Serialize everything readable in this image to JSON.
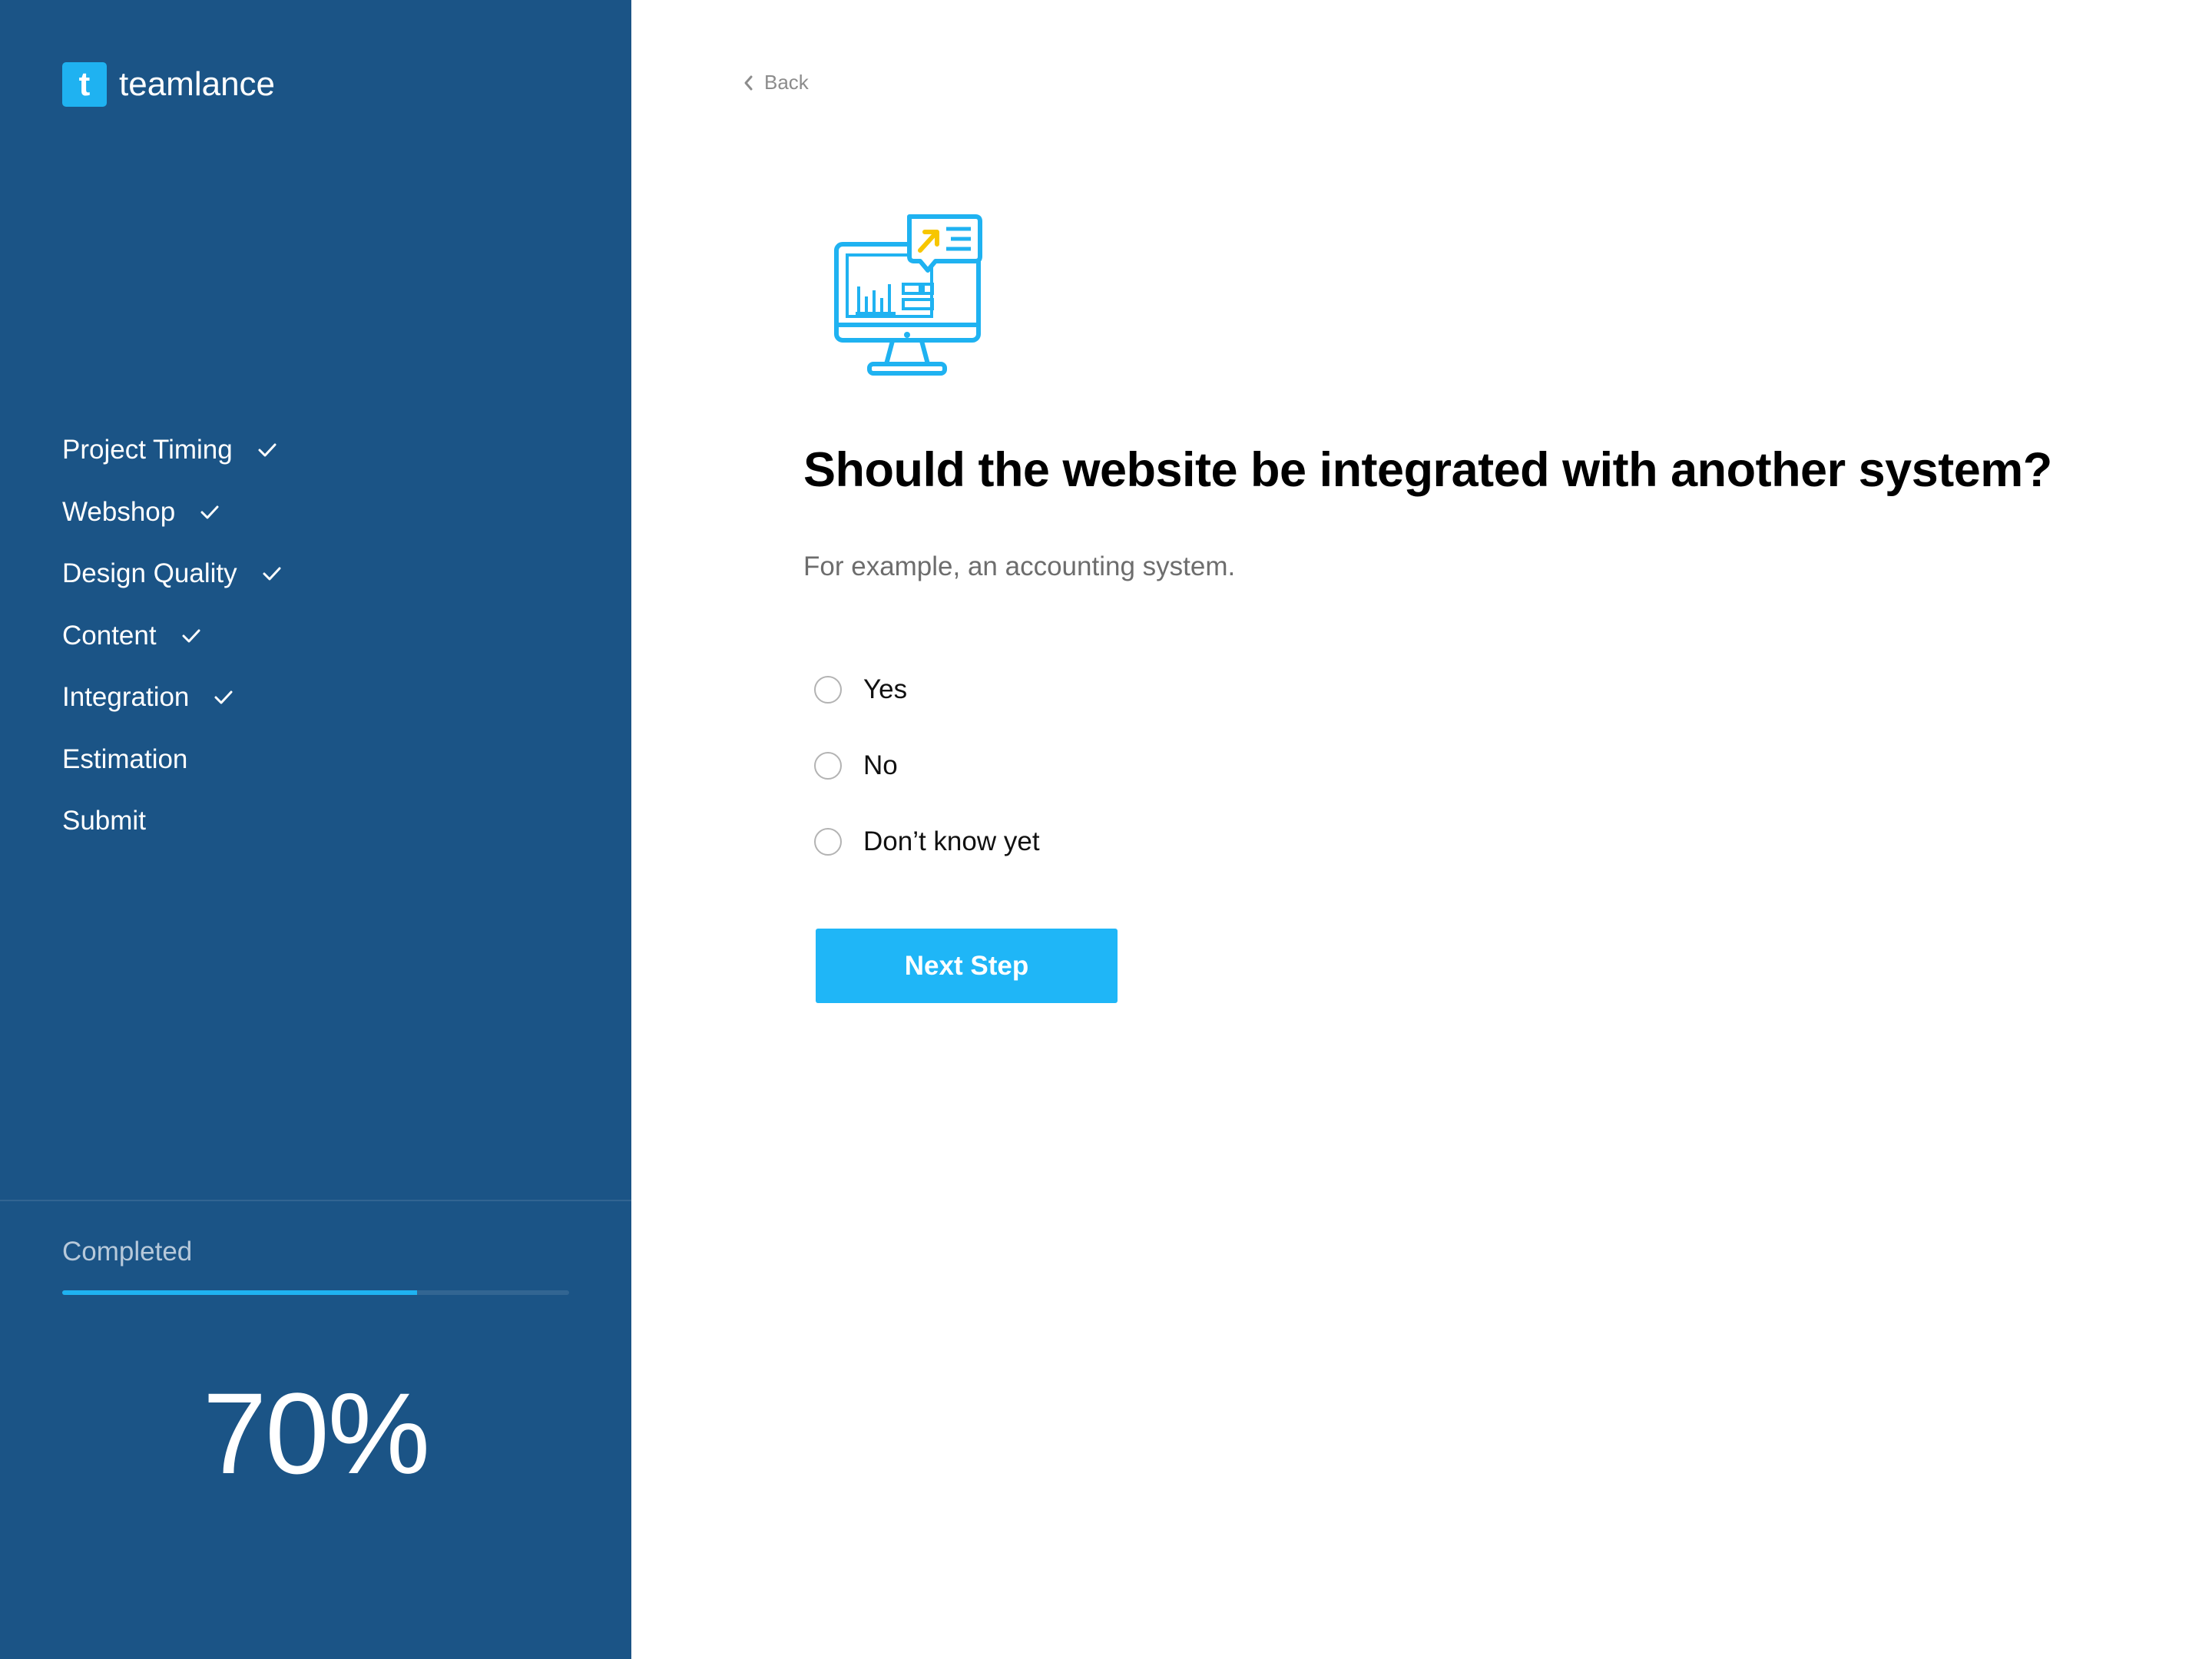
{
  "brand": {
    "logo_letter": "t",
    "name": "teamlance"
  },
  "sidebar": {
    "steps": [
      {
        "label": "Project Timing",
        "done": true
      },
      {
        "label": "Webshop",
        "done": true
      },
      {
        "label": "Design Quality",
        "done": true
      },
      {
        "label": "Content",
        "done": true
      },
      {
        "label": "Integration",
        "done": true
      },
      {
        "label": "Estimation",
        "done": false
      },
      {
        "label": "Submit",
        "done": false
      }
    ],
    "completed_label": "Completed",
    "progress_fraction": 0.7,
    "percent_text": "70%"
  },
  "main": {
    "back_label": "Back",
    "question": "Should the website be integrated with another system?",
    "hint": "For example, an accounting system.",
    "options": [
      {
        "label": "Yes",
        "selected": false
      },
      {
        "label": "No",
        "selected": false
      },
      {
        "label": "Don’t know yet",
        "selected": false
      }
    ],
    "next_label": "Next Step"
  },
  "icons": {
    "logo": "teamlance-logo-icon",
    "check": "checkmark-icon",
    "back": "chevron-left-icon",
    "illustration": "monitor-analytics-icon"
  },
  "colors": {
    "sidebar_bg": "#1b5486",
    "accent": "#1fb6f7",
    "illustration_highlight": "#f7c600"
  }
}
